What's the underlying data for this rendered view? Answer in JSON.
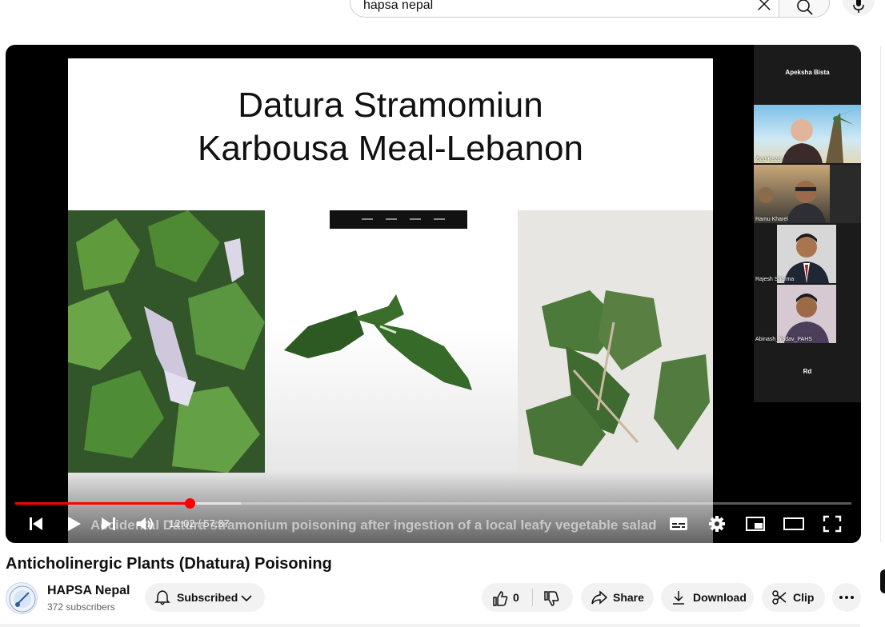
{
  "search": {
    "query": "hapsa nepal"
  },
  "icons": {
    "clear": "close-icon",
    "search": "search-icon",
    "mic": "microphone-icon",
    "prev": "previous-icon",
    "play": "play-icon",
    "next": "next-icon",
    "volume": "volume-icon",
    "captions": "subtitles-icon",
    "settings": "gear-icon",
    "miniplayer": "miniplayer-icon",
    "theater": "theater-mode-icon",
    "fullscreen": "fullscreen-icon",
    "bell": "bell-icon",
    "chevron": "chevron-down-icon",
    "like": "thumbs-up-icon",
    "dislike": "thumbs-down-icon",
    "share": "share-icon",
    "download": "download-icon",
    "clip": "scissors-icon",
    "more": "more-icon"
  },
  "player": {
    "slide_title_line1": "Datura Stramomiun",
    "slide_title_line2": "Karbousa Meal-Lebanon",
    "caption": "Accidental Datura stramonium poisoning after ingestion of a local leafy vegetable salad",
    "time_display": "12:02 / 57:37",
    "progress_fraction": 0.209,
    "buffered_fraction": 0.27,
    "accent": "#ff0000"
  },
  "participants": {
    "host": "Apeksha Bista",
    "tiles": [
      "Ziad Kazzi",
      "Ramu Kharel",
      "Rajesh Sharma",
      "Abinash_Yadav_PAHS"
    ],
    "bottom": "Rd"
  },
  "video": {
    "title": "Anticholinergic Plants (Dhatura) Poisoning"
  },
  "channel": {
    "name": "HAPSA Nepal",
    "subscribers": "372 subscribers",
    "subscribe_label": "Subscribed"
  },
  "actions": {
    "like_count": "0",
    "share": "Share",
    "download": "Download",
    "clip": "Clip"
  }
}
